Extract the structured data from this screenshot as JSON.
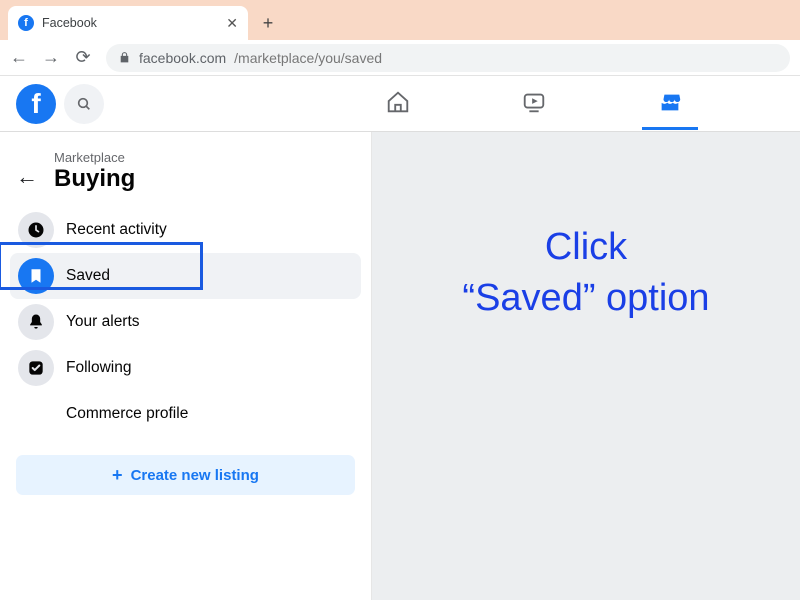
{
  "browser": {
    "tab_title": "Facebook",
    "url_host": "facebook.com",
    "url_path": "/marketplace/you/saved"
  },
  "sidebar": {
    "breadcrumb": "Marketplace",
    "title": "Buying",
    "items": [
      {
        "label": "Recent activity"
      },
      {
        "label": "Saved"
      },
      {
        "label": "Your alerts"
      },
      {
        "label": "Following"
      },
      {
        "label": "Commerce profile"
      }
    ],
    "create_label": "Create new listing"
  },
  "annotation": {
    "line1": "Click",
    "line2": "“Saved” option"
  }
}
